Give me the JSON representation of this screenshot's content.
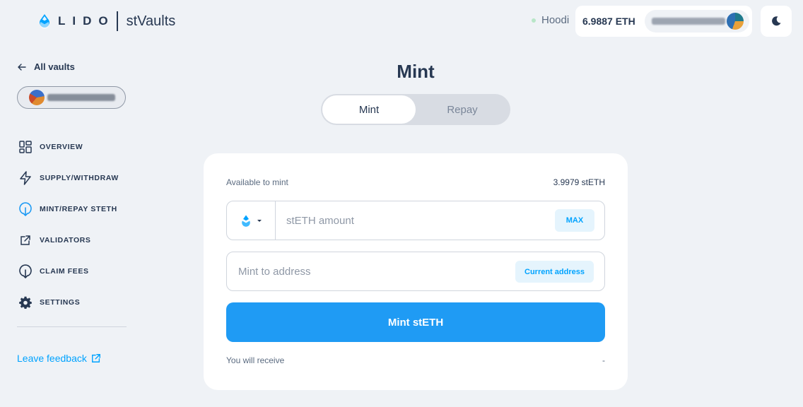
{
  "header": {
    "logo_text": "LIDO",
    "product_name": "stVaults",
    "network": "Hoodi",
    "wallet_balance": "6.9887 ETH"
  },
  "sidebar": {
    "back_label": "All vaults",
    "nav": [
      {
        "label": "OVERVIEW",
        "icon": "grid-icon"
      },
      {
        "label": "SUPPLY/WITHDRAW",
        "icon": "lightning-icon"
      },
      {
        "label": "MINT/REPAY STETH",
        "icon": "mint-icon"
      },
      {
        "label": "VALIDATORS",
        "icon": "external-link-icon"
      },
      {
        "label": "CLAIM FEES",
        "icon": "claim-icon"
      },
      {
        "label": "SETTINGS",
        "icon": "gear-icon"
      }
    ],
    "active_index": 2,
    "feedback_label": "Leave feedback"
  },
  "main": {
    "title": "Mint",
    "tabs": [
      {
        "label": "Mint",
        "selected": true
      },
      {
        "label": "Repay",
        "selected": false
      }
    ],
    "available_label": "Available to mint",
    "available_value": "3.9979 stETH",
    "amount_placeholder": "stETH amount",
    "max_label": "MAX",
    "address_placeholder": "Mint to address",
    "current_address_label": "Current address",
    "submit_label": "Mint stETH",
    "receive_label": "You will receive",
    "receive_value": "-"
  },
  "colors": {
    "accent": "#00a3ff",
    "button": "#1f9bf4",
    "text": "#273852",
    "background": "#eff2f6"
  }
}
